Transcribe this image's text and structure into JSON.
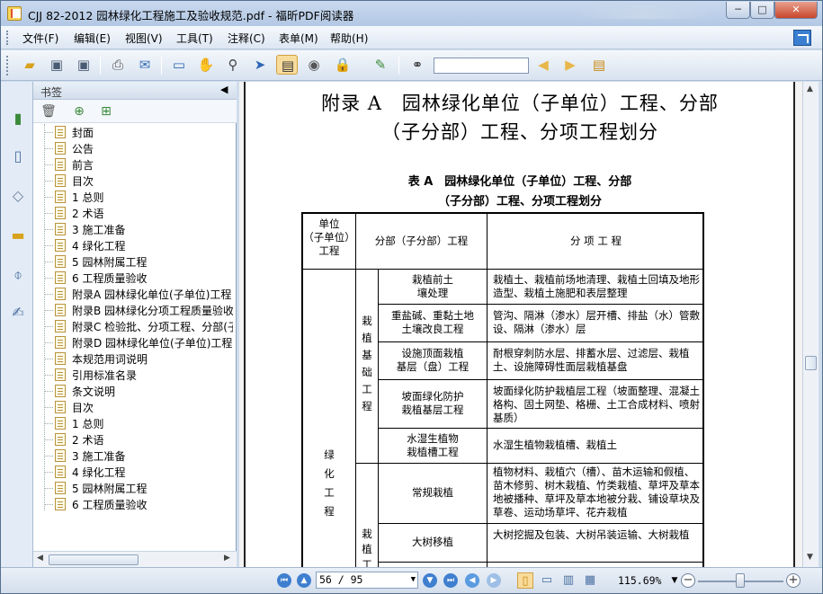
{
  "window": {
    "title": "CJJ 82-2012 园林绿化工程施工及验收规范.pdf - 福昕PDF阅读器",
    "min_label": "─",
    "max_label": "□",
    "close_label": "✕"
  },
  "menu": {
    "items": [
      "文件(F)",
      "编辑(E)",
      "视图(V)",
      "工具(T)",
      "注释(C)",
      "表单(M)",
      "帮助(H)"
    ]
  },
  "toolbar": {
    "search_placeholder": ""
  },
  "sidebar": {
    "title": "书签",
    "collapse_glyph": "◀",
    "bookmarks": [
      "封面",
      "公告",
      "前言",
      "目次",
      "1 总则",
      "2 术语",
      "3 施工准备",
      "4 绿化工程",
      "5 园林附属工程",
      "6 工程质量验收",
      "附录A 园林绿化单位(子单位)工程",
      "附录B 园林绿化分项工程质量验收",
      "附录C 检验批、分项工程、分部(子",
      "附录D 园林绿化单位(子单位)工程",
      "本规范用词说明",
      "引用标准名录",
      "条文说明",
      "目次",
      "1 总则",
      "2 术语",
      "3 施工准备",
      "4 绿化工程",
      "5 园林附属工程",
      "6 工程质量验收"
    ]
  },
  "document": {
    "heading_line1": "附录 A　园林绿化单位（子单位）工程、分部",
    "heading_line2": "（子分部）工程、分项工程划分",
    "caption_line1": "表 A　园林绿化单位（子单位）工程、分部",
    "caption_line2": "（子分部）工程、分项工程划分",
    "table": {
      "header_unit": "单位\n（子单位）\n工程",
      "header_part": "分部（子分部）工程",
      "header_item": "分 项 工 程",
      "unit_name": "绿\n化\n工\n程",
      "group1": "栽\n植\n基\n础\n工\n程",
      "group2": "栽\n植\n工",
      "rows": [
        {
          "sub": "栽植前土\n壤处理",
          "items": "栽植土、栽植前场地清理、栽植土回填及地形造型、栽植土施肥和表层整理"
        },
        {
          "sub": "重盐碱、重黏土地\n土壤改良工程",
          "items": "管沟、隔淋（渗水）层开槽、排盐（水）管敷设、隔淋（渗水）层"
        },
        {
          "sub": "设施顶面栽植\n基层（盘）工程",
          "items": "耐根穿刺防水层、排蓄水层、过滤层、栽植土、设施障碍性面层栽植基盘"
        },
        {
          "sub": "坡面绿化防护\n栽植基层工程",
          "items": "坡面绿化防护栽植层工程（坡面整理、混凝土格构、固土网垫、格栅、土工合成材料、喷射基质）"
        },
        {
          "sub": "水湿生植物\n栽植槽工程",
          "items": "水湿生植物栽植槽、栽植土"
        },
        {
          "sub": "常规栽植",
          "items": "植物材料、栽植穴（槽）、苗木运输和假植、苗木修剪、树木栽植、竹类栽植、草坪及草本地被播种、草坪及草本地被分栽、铺设草块及草卷、运动场草坪、花卉栽植"
        },
        {
          "sub": "大树移植",
          "items": "大树挖掘及包装、大树吊装运输、大树栽植"
        }
      ]
    }
  },
  "status": {
    "page_display": "56 / 95",
    "zoom": "115.69%"
  }
}
